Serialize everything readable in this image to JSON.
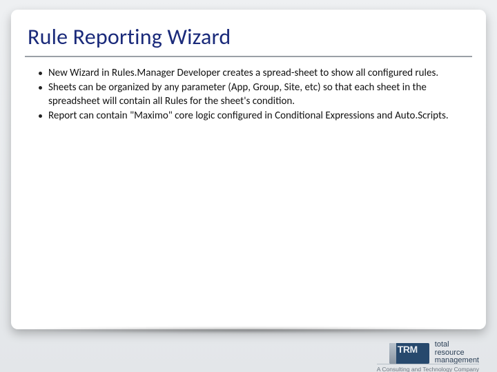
{
  "slide": {
    "title": "Rule Reporting Wizard",
    "bullets": [
      "New Wizard in Rules.Manager Developer creates a spread-sheet to show all configured rules.",
      "Sheets can be organized by any parameter (App, Group, Site, etc) so that each sheet in the spreadsheet will contain all Rules for the sheet's condition.",
      "Report can contain \"Maximo\" core logic configured in Conditional Expressions and Auto.Scripts."
    ]
  },
  "footer": {
    "logo_mark_text": "TRM",
    "logo_line1": "total",
    "logo_line2": "resource",
    "logo_line3": "management",
    "tagline": "A Consulting and Technology Company"
  }
}
